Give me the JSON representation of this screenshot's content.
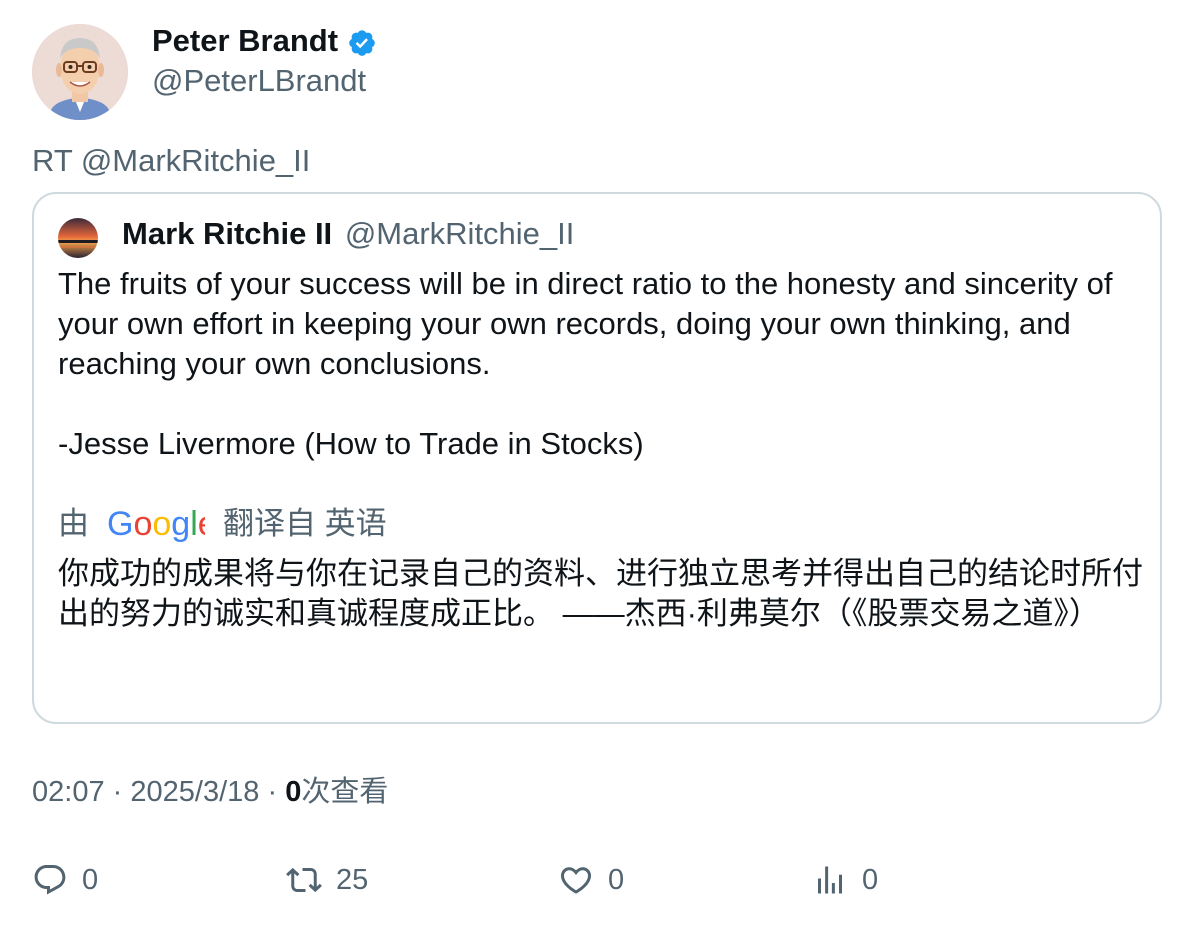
{
  "author": {
    "display_name": "Peter Brandt",
    "handle": "@PeterLBrandt",
    "verified": true
  },
  "retweet_line": "RT @MarkRitchie_II",
  "quote": {
    "display_name": "Mark Ritchie II",
    "handle": "@MarkRitchie_II",
    "text": "The fruits of your success will be in direct ratio to the honesty and sincerity of your own effort in keeping your own records, doing your own thinking, and reaching your own conclusions.\n\n-Jesse Livermore (How to Trade in Stocks)",
    "translation": {
      "prefix": "由",
      "provider_logo_text": "Google",
      "suffix": "翻译自 英语",
      "text": "你成功的成果将与你在记录自己的资料、进行独立思考并得出自己的结论时所付出的努力的诚实和真诚程度成正比。 ——杰西·利弗莫尔（《股票交易之道》）"
    }
  },
  "meta": {
    "time": "02:07",
    "separator": "·",
    "date": "2025/3/18",
    "views_count": "0",
    "views_label": "次查看"
  },
  "actions": {
    "reply": {
      "icon": "reply-icon",
      "count": "0"
    },
    "retweet": {
      "icon": "retweet-icon",
      "count": "25"
    },
    "like": {
      "icon": "heart-icon",
      "count": "0"
    },
    "views": {
      "icon": "analytics-icon",
      "count": "0"
    }
  },
  "colors": {
    "text_primary": "#0f1419",
    "text_secondary": "#536471",
    "border": "#cfd9de",
    "verified_blue": "#1d9bf0"
  }
}
